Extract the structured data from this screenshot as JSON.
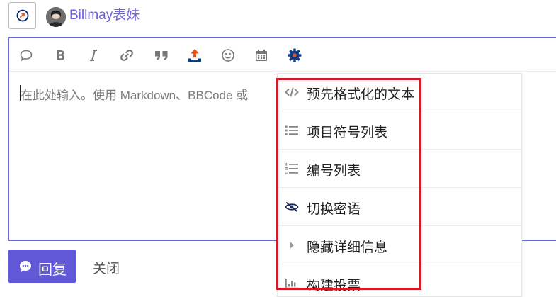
{
  "user": {
    "name": "Billmay表妹"
  },
  "editor": {
    "placeholder": "在此处输入。使用 Markdown、BBCode 或"
  },
  "toolbar": {
    "buttons": [
      "quote-icon",
      "bold-icon",
      "italic-icon",
      "link-icon",
      "blockquote-icon",
      "upload-icon",
      "emoji-icon",
      "calendar-icon",
      "gear-icon"
    ]
  },
  "dropdown": {
    "items": [
      {
        "label": "预先格式化的文本",
        "icon": "code-icon"
      },
      {
        "label": "项目符号列表",
        "icon": "bullet-list-icon"
      },
      {
        "label": "编号列表",
        "icon": "numbered-list-icon"
      },
      {
        "label": "切换密语",
        "icon": "eye-slash-icon"
      },
      {
        "label": "隐藏详细信息",
        "icon": "caret-right-icon"
      },
      {
        "label": "构建投票",
        "icon": "bar-chart-icon"
      }
    ]
  },
  "actions": {
    "reply_label": "回复",
    "close_label": "关闭"
  },
  "colors": {
    "accent": "#6158d8",
    "username": "#6b63d9",
    "highlight": "#d11a2a",
    "upload": "#e4561b",
    "gear": "#0a3a8a"
  }
}
